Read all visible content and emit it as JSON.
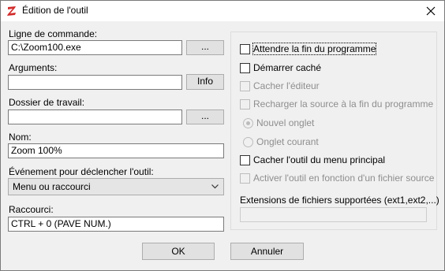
{
  "window": {
    "title": "Édition de l'outil",
    "icon": "app-z-icon"
  },
  "left": {
    "command_label": "Ligne de commande:",
    "command_value": "C:\\Zoom100.exe",
    "browse_label": "...",
    "arguments_label": "Arguments:",
    "arguments_value": "",
    "info_label": "Info",
    "workdir_label": "Dossier de travail:",
    "workdir_value": "",
    "workdir_browse_label": "...",
    "name_label": "Nom:",
    "name_value": "Zoom 100%",
    "event_label": "Événement pour déclencher l'outil:",
    "event_value": "Menu ou raccourci",
    "shortcut_label": "Raccourci:",
    "shortcut_value": "CTRL + 0 (PAVE NUM.)"
  },
  "right": {
    "wait_end": {
      "label": "Attendre la fin du programme",
      "checked": false,
      "enabled": true
    },
    "start_hidden": {
      "label": "Démarrer caché",
      "checked": false,
      "enabled": true
    },
    "hide_editor": {
      "label": "Cacher l'éditeur",
      "checked": false,
      "enabled": false
    },
    "reload_source": {
      "label": "Recharger la source à la fin du programme",
      "checked": false,
      "enabled": false
    },
    "new_tab": {
      "label": "Nouvel onglet",
      "checked": true,
      "enabled": false
    },
    "current_tab": {
      "label": "Onglet courant",
      "checked": false,
      "enabled": false
    },
    "hide_from_menu": {
      "label": "Cacher l'outil du menu principal",
      "checked": false,
      "enabled": true
    },
    "activate_by_source": {
      "label": "Activer l'outil en fonction d'un fichier source",
      "checked": false,
      "enabled": false
    },
    "extensions_label": "Extensions de fichiers supportées (ext1,ext2,...)",
    "extensions_value": ""
  },
  "footer": {
    "ok_label": "OK",
    "cancel_label": "Annuler"
  }
}
